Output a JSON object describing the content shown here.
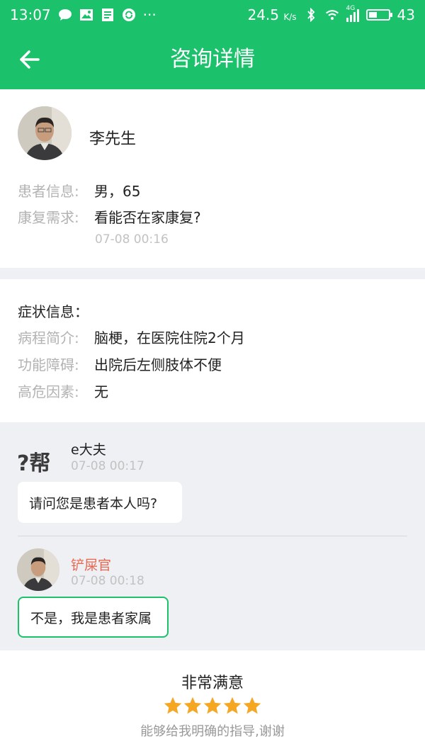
{
  "status_bar": {
    "time": "13:07",
    "net_speed": "24.5",
    "net_speed_unit": "K/s",
    "signal_type": "4G",
    "battery": "43",
    "colors": {
      "background": "#1cc16c"
    }
  },
  "header": {
    "title": "咨询详情",
    "back_icon": "arrow-left-icon"
  },
  "patient": {
    "name": "李先生",
    "info_label": "患者信息:",
    "info_value": "男，65",
    "need_label": "康复需求:",
    "need_value": "看能否在家康复?",
    "time": "07-08 00:16"
  },
  "symptoms": {
    "title": "症状信息：",
    "rows": [
      {
        "label": "病程简介:",
        "value": "脑梗，在医院住院2个月"
      },
      {
        "label": "功能障碍:",
        "value": "出院后左侧肢体不便"
      },
      {
        "label": "高危因素:",
        "value": "无"
      }
    ]
  },
  "messages": [
    {
      "sender": "e大夫",
      "time": "07-08 00:17",
      "text": "请问您是患者本人吗?",
      "avatar_text": "?帮",
      "name_color": "#222222",
      "bubble_border": "none"
    },
    {
      "sender": "铲屎官",
      "time": "07-08 00:18",
      "text": "不是，我是患者家属",
      "avatar_text": "",
      "name_color": "#e8664f",
      "bubble_border": "#1cc16c"
    }
  ],
  "review": {
    "title": "非常满意",
    "stars": 5,
    "max_stars": 5,
    "star_color": "#f5a623",
    "comment": "能够给我明确的指导,谢谢"
  }
}
